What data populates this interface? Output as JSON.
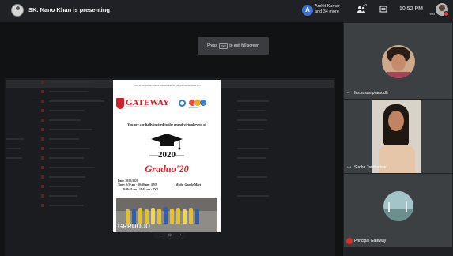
{
  "topbar": {
    "presenting_text": "SK. Nano Khan is presenting",
    "participants_initial": "A",
    "participants_line1": "Archit Kumar",
    "participants_line2": "and 34 more",
    "people_badge": "40",
    "time": "10:52 PM",
    "self_label": "You",
    "icons": [
      "presentation-icon",
      "people-icon",
      "chat-icon"
    ]
  },
  "share": {
    "fullscreen_toast": {
      "before": "Press",
      "key": "Esc",
      "after": "to exit full screen"
    },
    "flyer": {
      "tagline": "May he give you the desire of heart and make all your plans succeed psalm 20:4",
      "school_name": "GATEWAY",
      "school_sub": "INTERNATIONAL SCHOOL",
      "partner_sub": "ACHIEVERS",
      "invite_text": "You are cordially invited to the grand virtual event of",
      "year": "2020",
      "event_name": "Graduo'20",
      "date": "Date: 30/05/2020",
      "slot1": "Time: 9:30 am - 10:30 am - EYP",
      "slot2": "9:40:45 am - 11:45 am - PYP",
      "mode": "Mode: Google Meet",
      "banner": "GRRUUUU"
    }
  },
  "tiles": [
    {
      "name": "Ms.susan pramodh"
    },
    {
      "name": "Sudha Tamilselvan"
    },
    {
      "name": "Principal Gateway"
    }
  ],
  "colors": {
    "background": "#202124",
    "tile": "#3c4043",
    "brand_red": "#c9222a",
    "accent_blue": "#8ab4f8",
    "record_red": "#e53935"
  }
}
